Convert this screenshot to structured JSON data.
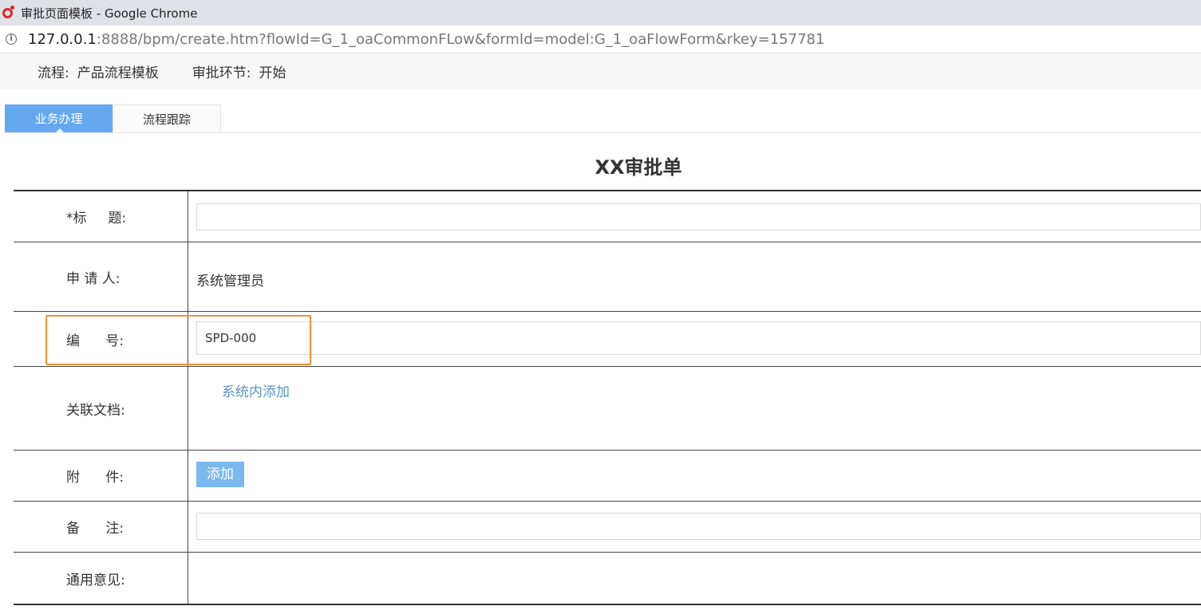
{
  "window": {
    "title": "审批页面模板 - Google Chrome"
  },
  "address": {
    "host": "127.0.0.1",
    "rest": ":8888/bpm/create.htm?flowId=G_1_oaCommonFLow&formId=model:G_1_oaFlowForm&rkey=157781"
  },
  "flow": {
    "process_label": "流程:",
    "process_value": "产品流程模板",
    "step_label": "审批环节:",
    "step_value": "开始"
  },
  "tabs": [
    {
      "label": "业务办理",
      "active": true
    },
    {
      "label": "流程跟踪",
      "active": false
    }
  ],
  "form": {
    "title": "XX审批单",
    "rows": {
      "title": {
        "label": "*标     题:",
        "value": ""
      },
      "applicant": {
        "label": "申 请 人:",
        "value": "系统管理员"
      },
      "number": {
        "label": "编      号:",
        "value": "SPD-000"
      },
      "related_docs": {
        "label": "关联文档:",
        "link": "系统内添加"
      },
      "attachment": {
        "label": "附      件:",
        "button": "添加"
      },
      "remark": {
        "label": "备      注:",
        "value": ""
      },
      "opinion": {
        "label": "通用意见:"
      }
    }
  },
  "colors": {
    "accent": "#64a8f0",
    "highlight": "#f0913a",
    "link": "#5b93c7"
  }
}
